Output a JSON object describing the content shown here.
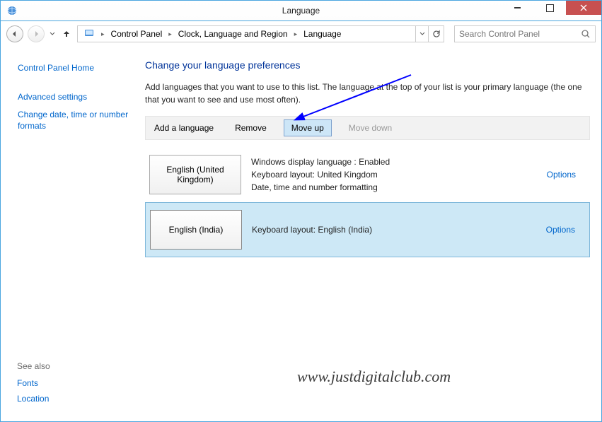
{
  "window": {
    "title": "Language"
  },
  "breadcrumbs": {
    "root_icon": "control-panel-icon",
    "items": [
      "Control Panel",
      "Clock, Language and Region",
      "Language"
    ]
  },
  "search": {
    "placeholder": "Search Control Panel"
  },
  "sidebar": {
    "home": "Control Panel Home",
    "advanced": "Advanced settings",
    "change_formats": "Change date, time or number formats"
  },
  "see_also": {
    "header": "See also",
    "fonts": "Fonts",
    "location": "Location"
  },
  "main": {
    "heading": "Change your language preferences",
    "intro": "Add languages that you want to use to this list. The language at the top of your list is your primary language (the one that you want to see and use most often)."
  },
  "toolbar": {
    "add": "Add a language",
    "remove": "Remove",
    "moveup": "Move up",
    "movedown": "Move down"
  },
  "languages": [
    {
      "name": "English (United Kingdom)",
      "details_line1": "Windows display language : Enabled",
      "details_line2": "Keyboard layout: United Kingdom",
      "details_line3": "Date, time and number formatting",
      "options": "Options",
      "selected": false
    },
    {
      "name": "English (India)",
      "details_line1": "Keyboard layout: English (India)",
      "details_line2": "",
      "details_line3": "",
      "options": "Options",
      "selected": true
    }
  ],
  "watermark": "www.justdigitalclub.com"
}
